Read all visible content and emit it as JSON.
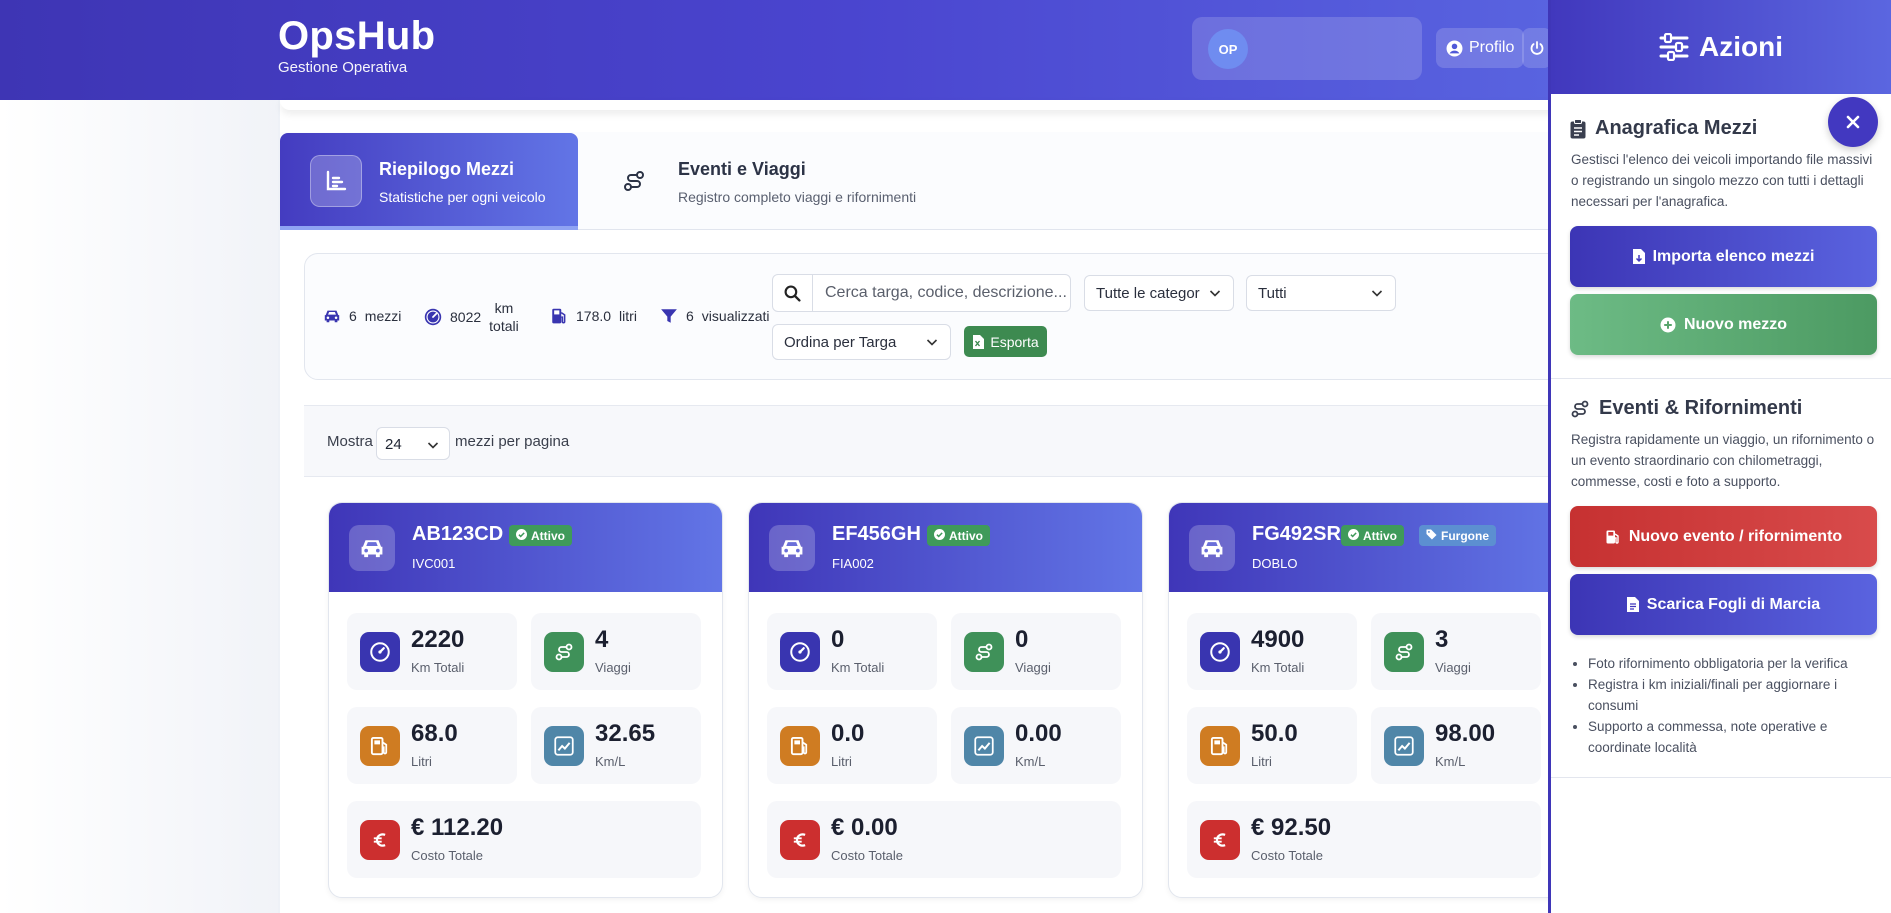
{
  "header": {
    "app_name": "OpsHub",
    "app_subtitle": "Gestione Operativa",
    "user_initials": "OP",
    "profile_label": "Profilo"
  },
  "tabs": [
    {
      "title": "Riepilogo Mezzi",
      "subtitle": "Statistiche per ogni veicolo",
      "active": true
    },
    {
      "title": "Eventi e Viaggi",
      "subtitle": "Registro completo viaggi e rifornimenti",
      "active": false
    }
  ],
  "stats": {
    "vehicles_value": "6",
    "vehicles_label": "mezzi",
    "km_value": "8022",
    "km_label_1": "km",
    "km_label_2": "totali",
    "liters_value": "178.0",
    "liters_label": "litri",
    "shown_value": "6",
    "shown_label": "visualizzati"
  },
  "filters": {
    "search_placeholder": "Cerca targa, codice, descrizione...",
    "category": "Tutte le categor",
    "status": "Tutti",
    "sort": "Ordina per Targa",
    "export_label": "Esporta"
  },
  "pagination": {
    "show_label": "Mostra",
    "per_page": "24",
    "per_page_label": "mezzi per pagina"
  },
  "vehicles": [
    {
      "plate": "AB123CD",
      "code": "IVC001",
      "status": "Attivo",
      "km": "2220",
      "trips": "4",
      "liters": "68.0",
      "kml": "32.65",
      "cost": "€ 112.20"
    },
    {
      "plate": "EF456GH",
      "code": "FIA002",
      "status": "Attivo",
      "km": "0",
      "trips": "0",
      "liters": "0.0",
      "kml": "0.00",
      "cost": "€ 0.00"
    },
    {
      "plate": "FG492SR",
      "code": "DOBLO",
      "status": "Attivo",
      "category": "Furgone",
      "km": "4900",
      "trips": "3",
      "liters": "50.0",
      "kml": "98.00",
      "cost": "€ 92.50"
    }
  ],
  "tile_labels": {
    "km": "Km Totali",
    "trips": "Viaggi",
    "liters": "Litri",
    "kml": "Km/L",
    "cost": "Costo Totale"
  },
  "sidebar": {
    "title": "Azioni",
    "section1_title": "Anagrafica Mezzi",
    "section1_text": "Gestisci l'elenco dei veicoli importando file massivi o registrando un singolo mezzo con tutti i dettagli necessari per l'anagrafica.",
    "import_label": "Importa elenco mezzi",
    "new_vehicle_label": "Nuovo mezzo",
    "section2_title": "Eventi & Rifornimenti",
    "section2_text": "Registra rapidamente un viaggio, un rifornimento o un evento straordinario con chilometraggi, commesse, costi e foto a supporto.",
    "new_event_label": "Nuovo evento / rifornimento",
    "download_label": "Scarica Fogli di Marcia",
    "tips": [
      "Foto rifornimento obbligatoria per la verifica",
      "Registra i km iniziali/finali per aggiornare i consumi",
      "Supporto a commessa, note operative e coordinate località"
    ]
  },
  "colors": {
    "primary": "#4138bd",
    "success": "#3f9a5a",
    "danger": "#cc2f2f",
    "info": "#5c8fd1"
  }
}
